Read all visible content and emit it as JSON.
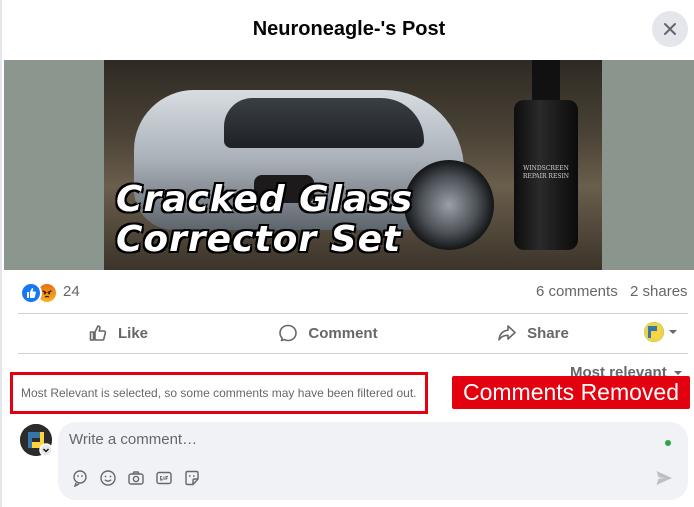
{
  "window": {
    "title": "Neuroneagle-'s Post"
  },
  "post": {
    "image_headline_line1": "Cracked Glass",
    "image_headline_line2": "Corrector Set",
    "bottle_label": "WINDSCREEN REPAIR RESIN"
  },
  "stats": {
    "reaction_count": "24",
    "reaction_types": [
      "like-icon",
      "angry-icon"
    ],
    "comments": "6 comments",
    "shares": "2 shares"
  },
  "actions": {
    "like": "Like",
    "comment": "Comment",
    "share": "Share"
  },
  "comments_section": {
    "sort_label": "Most relevant",
    "filter_note": "Most Relevant is selected, so some comments may have been filtered out.",
    "annotation": "Comments Removed",
    "input_placeholder": "Write a comment…",
    "tools": [
      "avatar-sticker-icon",
      "emoji-icon",
      "camera-icon",
      "gif-icon",
      "sticker-icon"
    ]
  },
  "colors": {
    "accent": "#1877f2",
    "annotation_red": "#e3000f",
    "muted_text": "#65676b",
    "online": "#31a24c"
  }
}
